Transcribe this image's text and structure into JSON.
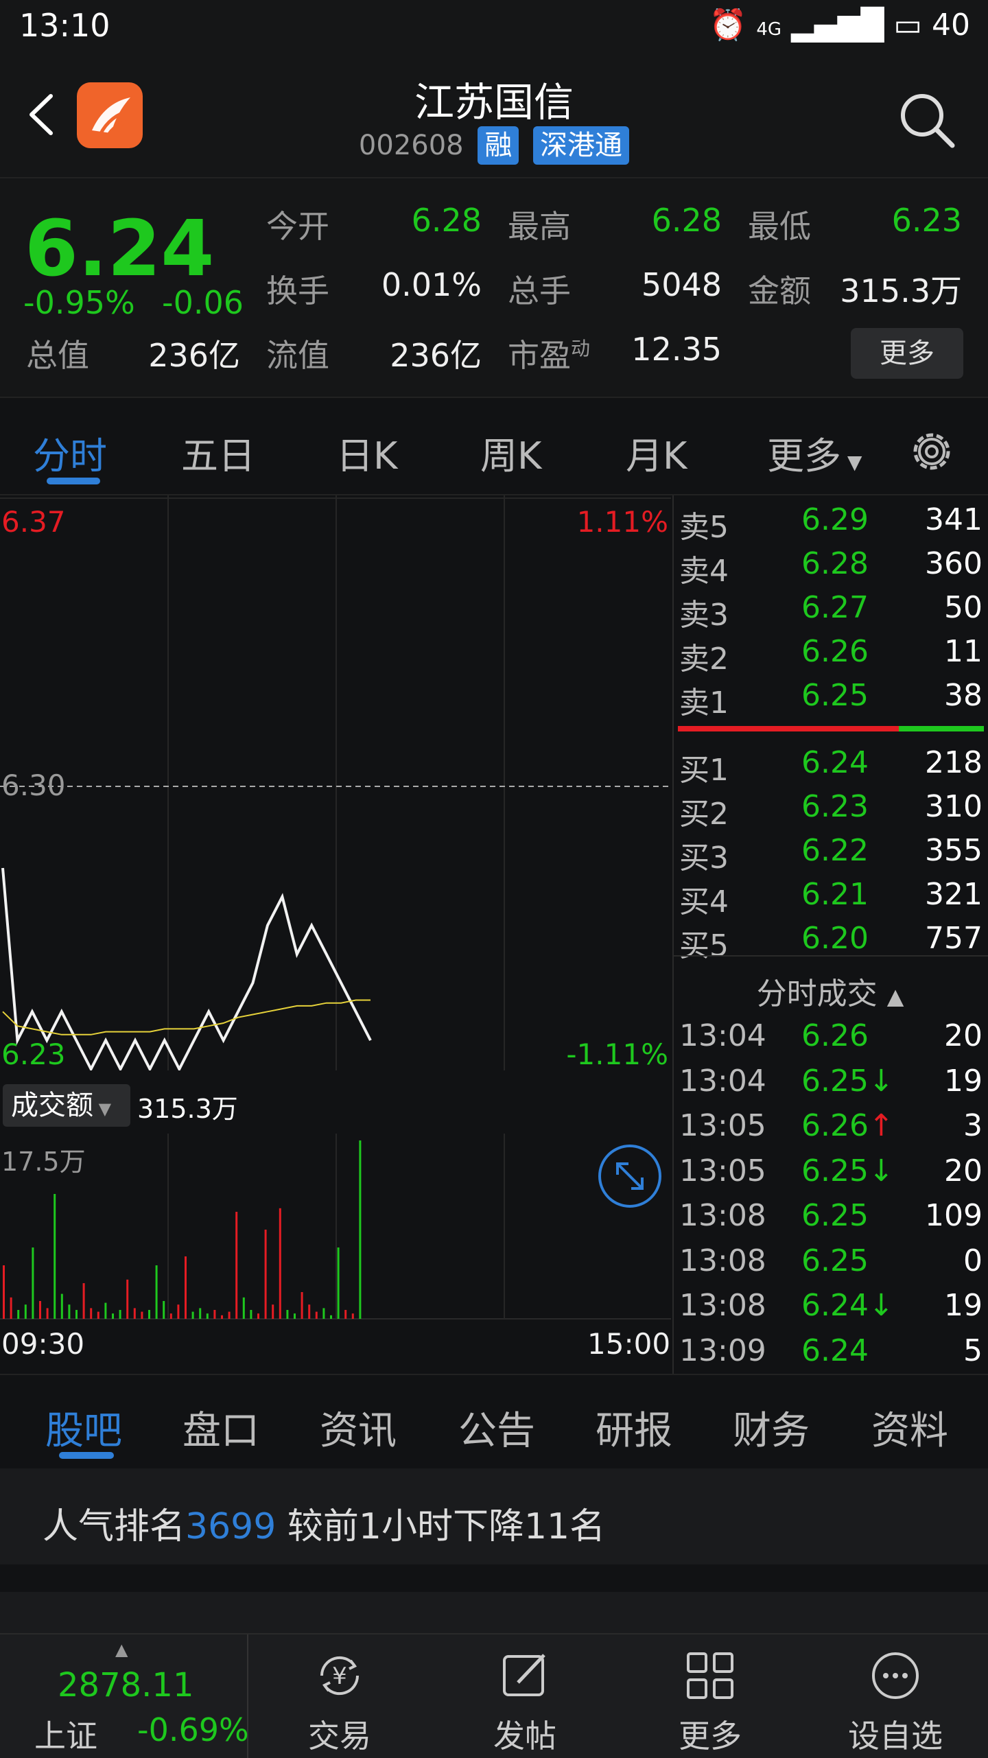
{
  "status_bar": {
    "time": "13:10",
    "network": "4G",
    "battery": "40"
  },
  "header": {
    "title": "江苏国信",
    "code": "002608",
    "tags": [
      "融",
      "深港通"
    ]
  },
  "quote": {
    "price": "6.24",
    "change_pct": "-0.95%",
    "change": "-0.06",
    "rows": [
      {
        "l1": "今开",
        "v1": "6.28",
        "l2": "最高",
        "v2": "6.28",
        "l3": "最低",
        "v3": "6.23"
      },
      {
        "l1": "换手",
        "v1": "0.01%",
        "l2": "总手",
        "v2": "5048",
        "l3": "金额",
        "v3": "315.3万"
      },
      {
        "l1": "流值",
        "v1": "236亿",
        "l2": "市盈",
        "v2": "12.35"
      }
    ],
    "total_value_label": "总值",
    "total_value": "236亿",
    "pe_sup": "动",
    "more": "更多"
  },
  "tabs": [
    "分时",
    "五日",
    "日K",
    "周K",
    "月K",
    "更多"
  ],
  "chart": {
    "price_top": "6.37",
    "pct_top": "1.11%",
    "mid_price": "6.30",
    "price_bottom": "6.23",
    "pct_bottom": "-1.11%",
    "volume_label": "成交额",
    "volume_value": "315.3万",
    "vol_max": "17.5万",
    "time_start": "09:30",
    "time_end": "15:00"
  },
  "chart_data": {
    "type": "line",
    "series": [
      {
        "values": [
          6.3,
          6.24,
          6.25,
          6.24,
          6.25,
          6.24,
          6.23,
          6.24,
          6.23,
          6.24,
          6.23,
          6.24,
          6.23,
          6.24,
          6.25,
          6.24,
          6.25,
          6.26,
          6.28,
          6.29,
          6.27,
          6.28,
          6.27,
          6.26,
          6.25,
          6.24
        ]
      },
      {
        "values": [
          6.25,
          6.245,
          6.244,
          6.243,
          6.242,
          6.242,
          6.242,
          6.243,
          6.243,
          6.243,
          6.243,
          6.244,
          6.244,
          6.244,
          6.245,
          6.246,
          6.248,
          6.249,
          6.25,
          6.251,
          6.252,
          6.252,
          6.253,
          6.253,
          6.254,
          6.254
        ]
      }
    ],
    "volume": [
      30,
      12,
      5,
      8,
      40,
      10,
      6,
      70,
      14,
      8,
      5,
      20,
      6,
      4,
      9,
      3,
      5,
      22,
      6,
      4,
      5,
      30,
      10,
      3,
      8,
      35,
      4,
      6,
      3,
      5,
      2,
      4,
      60,
      12,
      5,
      3,
      50,
      8,
      62,
      5,
      3,
      15,
      8,
      4,
      6,
      2,
      40,
      5,
      3,
      100
    ],
    "ylim": [
      6.23,
      6.37
    ]
  },
  "book": {
    "asks": [
      {
        "label": "卖5",
        "price": "6.29",
        "vol": "341"
      },
      {
        "label": "卖4",
        "price": "6.28",
        "vol": "360"
      },
      {
        "label": "卖3",
        "price": "6.27",
        "vol": "50"
      },
      {
        "label": "卖2",
        "price": "6.26",
        "vol": "11"
      },
      {
        "label": "卖1",
        "price": "6.25",
        "vol": "38"
      }
    ],
    "bids": [
      {
        "label": "买1",
        "price": "6.24",
        "vol": "218"
      },
      {
        "label": "买2",
        "price": "6.23",
        "vol": "310"
      },
      {
        "label": "买3",
        "price": "6.22",
        "vol": "355"
      },
      {
        "label": "买4",
        "price": "6.21",
        "vol": "321"
      },
      {
        "label": "买5",
        "price": "6.20",
        "vol": "757"
      }
    ],
    "trades_title": "分时成交",
    "trades": [
      {
        "time": "13:04",
        "price": "6.26",
        "arrow": "",
        "vol": "20",
        "color": "green"
      },
      {
        "time": "13:04",
        "price": "6.25",
        "arrow": "↓",
        "vol": "19",
        "color": "green"
      },
      {
        "time": "13:05",
        "price": "6.26",
        "arrow": "↑",
        "vol": "3",
        "color": "red"
      },
      {
        "time": "13:05",
        "price": "6.25",
        "arrow": "↓",
        "vol": "20",
        "color": "green"
      },
      {
        "time": "13:08",
        "price": "6.25",
        "arrow": "",
        "vol": "109",
        "color": "green"
      },
      {
        "time": "13:08",
        "price": "6.25",
        "arrow": "",
        "vol": "0",
        "color": "green"
      },
      {
        "time": "13:08",
        "price": "6.24",
        "arrow": "↓",
        "vol": "19",
        "color": "green"
      },
      {
        "time": "13:09",
        "price": "6.24",
        "arrow": "",
        "vol": "5",
        "color": "green"
      }
    ]
  },
  "bottom_tabs": [
    "股吧",
    "盘口",
    "资讯",
    "公告",
    "研报",
    "财务",
    "资料"
  ],
  "rank": {
    "prefix": "人气排名",
    "number": "3699",
    "suffix": "较前1小时下降11名"
  },
  "index": {
    "value": "2878.11",
    "name": "上证",
    "pct": "-0.69%"
  },
  "nav": [
    "交易",
    "发帖",
    "更多",
    "设自选"
  ]
}
